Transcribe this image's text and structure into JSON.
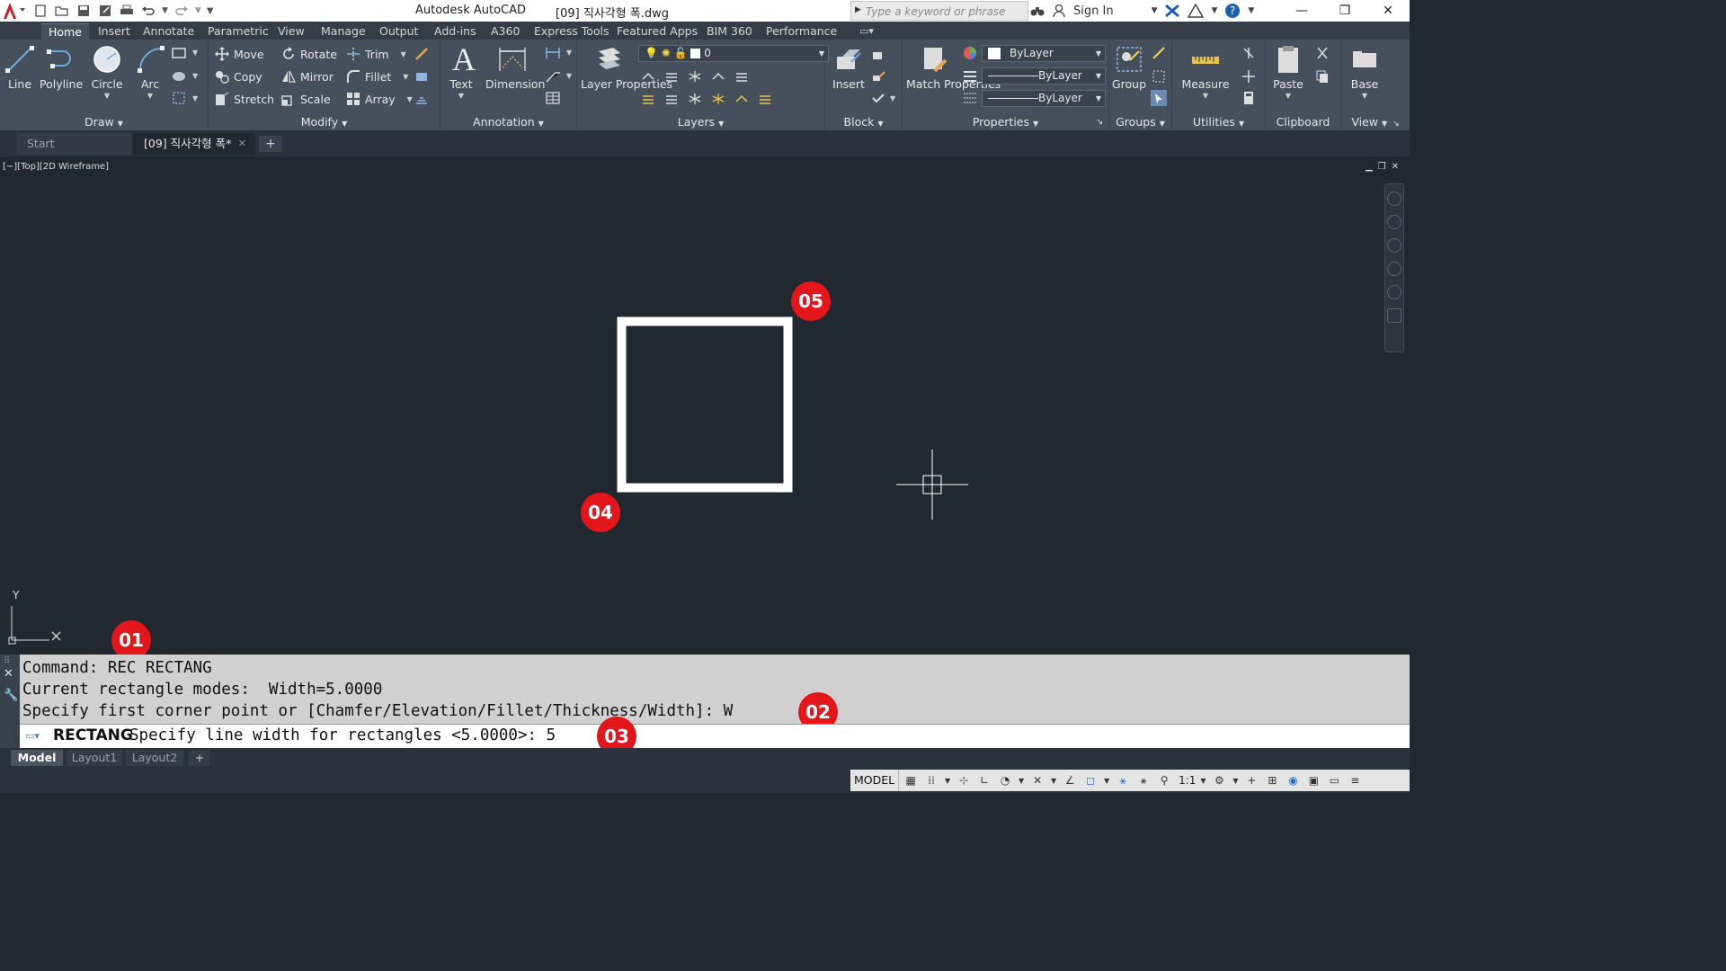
{
  "title_bar": {
    "app_name": "Autodesk AutoCAD",
    "file_name": "[09] 직사각형 폭.dwg",
    "search_placeholder": "Type a keyword or phrase",
    "signin_label": "Sign In"
  },
  "ribbon_tabs": [
    "Home",
    "Insert",
    "Annotate",
    "Parametric",
    "View",
    "Manage",
    "Output",
    "Add-ins",
    "A360",
    "Express Tools",
    "Featured Apps",
    "BIM 360",
    "Performance"
  ],
  "active_tab": "Home",
  "panels": {
    "draw": {
      "title": "Draw",
      "buttons": [
        "Line",
        "Polyline",
        "Circle",
        "Arc"
      ]
    },
    "modify": {
      "title": "Modify",
      "buttons": [
        "Move",
        "Rotate",
        "Trim",
        "Copy",
        "Mirror",
        "Fillet",
        "Stretch",
        "Scale",
        "Array"
      ]
    },
    "annotation": {
      "title": "Annotation",
      "buttons": [
        "Text",
        "Dimension"
      ]
    },
    "layers": {
      "title": "Layers",
      "layer_properties": "Layer Properties",
      "current_layer": "0"
    },
    "block": {
      "title": "Block",
      "insert": "Insert"
    },
    "properties": {
      "title": "Properties",
      "match": "Match Properties",
      "color": "ByLayer",
      "linetype": "ByLayer",
      "lineweight": "ByLayer"
    },
    "groups": {
      "title": "Groups",
      "group": "Group"
    },
    "utilities": {
      "title": "Utilities",
      "measure": "Measure"
    },
    "clipboard": {
      "title": "Clipboard",
      "paste": "Paste"
    },
    "view": {
      "title": "View",
      "base": "Base"
    }
  },
  "file_tabs": {
    "start": "Start",
    "current": "[09] 직사각형 폭*"
  },
  "viewport": {
    "label": "[−][Top][2D Wireframe]"
  },
  "ucs": {
    "x": "X",
    "y": "Y"
  },
  "markers": [
    "01",
    "02",
    "03",
    "04",
    "05"
  ],
  "command_history": [
    "Command: REC RECTANG",
    "Current rectangle modes:  Width=5.0000",
    "Specify first corner point or [Chamfer/Elevation/Fillet/Thickness/Width]: W"
  ],
  "command_line": {
    "command": "RECTANG",
    "prompt": "Specify line width for rectangles <5.0000>: 5"
  },
  "layout_tabs": [
    "Model",
    "Layout1",
    "Layout2"
  ],
  "status_bar": {
    "mode": "MODEL",
    "scale": "1:1"
  },
  "colors": {
    "canvas": "#212830",
    "ribbon": "#46505c",
    "marker": "#e3161b",
    "accent": "#1f6fd0"
  }
}
